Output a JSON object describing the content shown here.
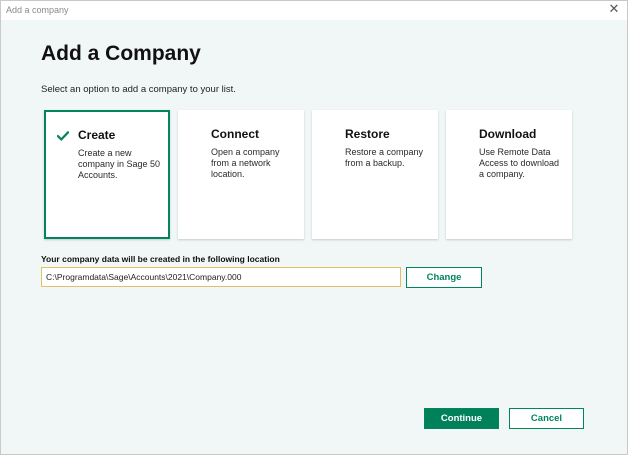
{
  "window": {
    "title": "Add a company",
    "close_glyph": "✕"
  },
  "header": {
    "title": "Add a Company",
    "subtitle": "Select an option to add a company to your list."
  },
  "options": [
    {
      "heading": "Create",
      "description": "Create a new company in Sage 50 Accounts.",
      "selected": true,
      "icon": "checkmark-icon"
    },
    {
      "heading": "Connect",
      "description": "Open a company from a network location.",
      "selected": false
    },
    {
      "heading": "Restore",
      "description": "Restore a company from a backup.",
      "selected": false
    },
    {
      "heading": "Download",
      "description": "Use Remote Data Access to download a company.",
      "selected": false
    }
  ],
  "location": {
    "label": "Your company data will be created in the following location",
    "path_value": "C:\\Programdata\\Sage\\Accounts\\2021\\Company.000",
    "change_label": "Change"
  },
  "footer": {
    "continue_label": "Continue",
    "cancel_label": "Cancel"
  },
  "colors": {
    "accent": "#00855f",
    "background": "#f1f6f6",
    "input_border": "#e1c066"
  }
}
